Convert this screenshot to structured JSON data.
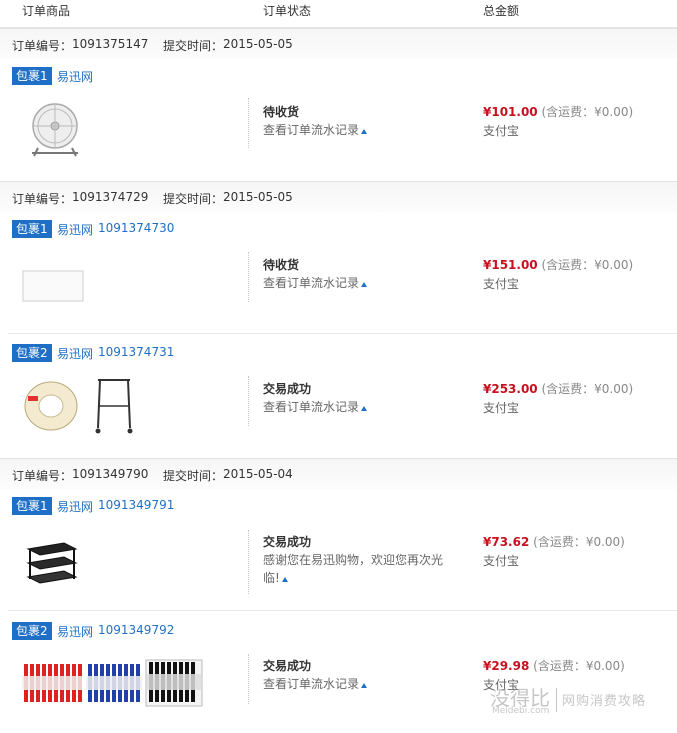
{
  "header": {
    "col_goods": "订单商品",
    "col_status": "订单状态",
    "col_total": "总金额"
  },
  "orders": [
    {
      "no_label": "订单编号：",
      "no": "1091375147",
      "time_label": "提交时间：",
      "time": "2015-05-05",
      "packages": [
        {
          "tag": "包裹1",
          "vendor": "易迅网",
          "sub_no": "",
          "status": "待收货",
          "track": "查看订单流水记录",
          "price": "¥101.00",
          "ship": "(含运费：¥0.00)",
          "pay": "支付宝"
        }
      ]
    },
    {
      "no_label": "订单编号：",
      "no": "1091374729",
      "time_label": "提交时间：",
      "time": "2015-05-05",
      "packages": [
        {
          "tag": "包裹1",
          "vendor": "易迅网",
          "sub_no": "1091374730",
          "status": "待收货",
          "track": "查看订单流水记录",
          "price": "¥151.00",
          "ship": "(含运费：¥0.00)",
          "pay": "支付宝"
        },
        {
          "tag": "包裹2",
          "vendor": "易迅网",
          "sub_no": "1091374731",
          "status": "交易成功",
          "track": "查看订单流水记录",
          "price": "¥253.00",
          "ship": "(含运费：¥0.00)",
          "pay": "支付宝"
        }
      ]
    },
    {
      "no_label": "订单编号：",
      "no": "1091349790",
      "time_label": "提交时间：",
      "time": "2015-05-04",
      "packages": [
        {
          "tag": "包裹1",
          "vendor": "易迅网",
          "sub_no": "1091349791",
          "status": "交易成功",
          "track": "感谢您在易迅购物，欢迎您再次光",
          "track2": "临!",
          "price": "¥73.62",
          "ship": "(含运费：¥0.00)",
          "pay": "支付宝"
        },
        {
          "tag": "包裹2",
          "vendor": "易迅网",
          "sub_no": "1091349792",
          "status": "交易成功",
          "track": "查看订单流水记录",
          "price": "¥29.98",
          "ship": "(含运费：¥0.00)",
          "pay": "支付宝"
        }
      ]
    }
  ],
  "watermark": {
    "text": "没得比",
    "domain": "Meidebi.com",
    "slogan": "网购消费攻略"
  }
}
